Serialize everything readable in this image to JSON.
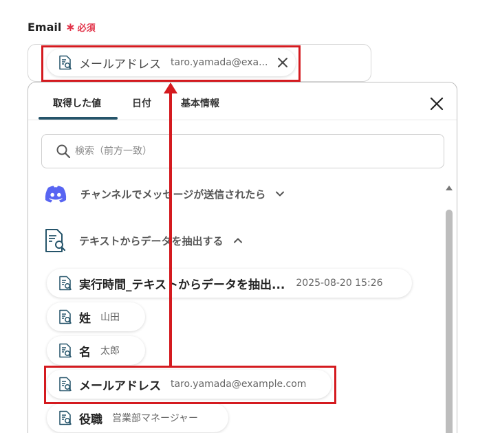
{
  "field": {
    "label": "Email",
    "required_mark": "∗",
    "required_text": "必須",
    "selected": {
      "title": "メールアドレス",
      "value": "taro.yamada@exa..."
    }
  },
  "panel": {
    "tabs": [
      {
        "label": "取得した値",
        "active": true
      },
      {
        "label": "日付",
        "active": false
      },
      {
        "label": "基本情報",
        "active": false
      }
    ],
    "search_placeholder": "検索（前方一致）",
    "sections": [
      {
        "label": "チャンネルでメッセージが送信されたら",
        "icon": "discord-icon",
        "expanded": false
      },
      {
        "label": "テキストからデータを抽出する",
        "icon": "document-search-icon",
        "expanded": true
      }
    ],
    "items": [
      {
        "title": "実行時間_テキストからデータを抽出...",
        "value": "2025-08-20 15:26"
      },
      {
        "title": "姓",
        "value": "山田"
      },
      {
        "title": "名",
        "value": "太郎"
      },
      {
        "title": "メールアドレス",
        "value": "taro.yamada@example.com"
      },
      {
        "title": "役職",
        "value": "営業部マネージャー"
      }
    ]
  },
  "colors": {
    "accent": "#25546a",
    "required": "#e2344a",
    "annotation": "#d41a1f",
    "discord": "#5865f2"
  }
}
